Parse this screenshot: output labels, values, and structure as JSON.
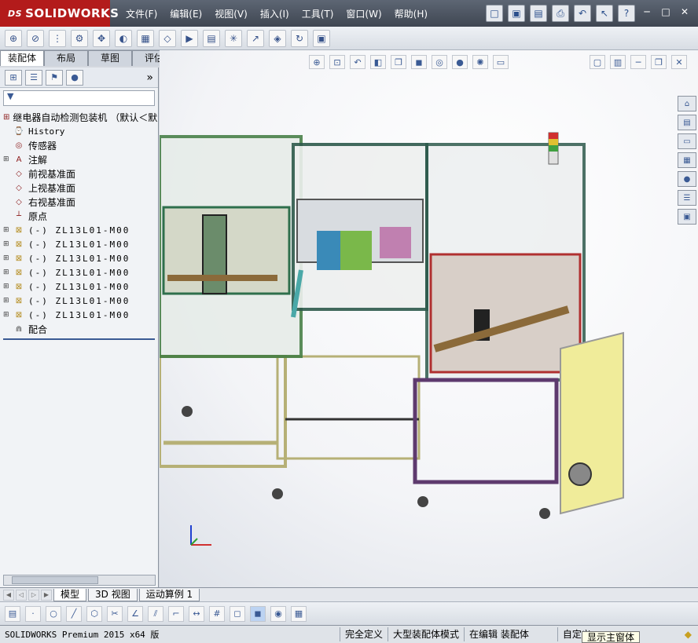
{
  "app": {
    "brand_ds": "DS",
    "brand_name": "SOLIDWORKS"
  },
  "menu": [
    "文件(F)",
    "编辑(E)",
    "视图(V)",
    "插入(I)",
    "工具(T)",
    "窗口(W)",
    "帮助(H)"
  ],
  "title_icons": [
    "new-doc-icon",
    "open-folder-icon",
    "save-icon",
    "print-icon",
    "undo-icon",
    "select-arrow-icon",
    "help-icon"
  ],
  "title_icon_glyphs": [
    "□",
    "▣",
    "▤",
    "⎙",
    "↶",
    "↖",
    "?"
  ],
  "tabs": [
    "装配体",
    "布局",
    "草图",
    "评估"
  ],
  "tree": {
    "filter_symbol": "▼",
    "root": "继电器自动检测包装机 （默认＜默",
    "items": [
      {
        "label": "History",
        "icon": "history-icon",
        "glyph": "⌚"
      },
      {
        "label": "传感器",
        "icon": "sensor-icon",
        "glyph": "◎"
      },
      {
        "label": "注解",
        "icon": "annotation-icon",
        "glyph": "A"
      },
      {
        "label": "前视基准面",
        "icon": "plane-icon",
        "glyph": "◇"
      },
      {
        "label": "上视基准面",
        "icon": "plane-icon",
        "glyph": "◇"
      },
      {
        "label": "右视基准面",
        "icon": "plane-icon",
        "glyph": "◇"
      },
      {
        "label": "原点",
        "icon": "origin-icon",
        "glyph": "┴"
      }
    ],
    "components": [
      "(-) ZL13L01-M00",
      "(-) ZL13L01-M00",
      "(-) ZL13L01-M00",
      "(-) ZL13L01-M00",
      "(-) ZL13L01-M00",
      "(-) ZL13L01-M00",
      "(-) ZL13L01-M00"
    ],
    "mates": "配合"
  },
  "sheet_tabs": [
    "模型",
    "3D 视图",
    "运动算例 1"
  ],
  "status": {
    "product": "SOLIDWORKS Premium 2015 x64 版",
    "cells": [
      "完全定义",
      "大型装配体模式",
      "在编辑 装配体",
      "自定义"
    ],
    "tooltip": "显示主窗体"
  }
}
